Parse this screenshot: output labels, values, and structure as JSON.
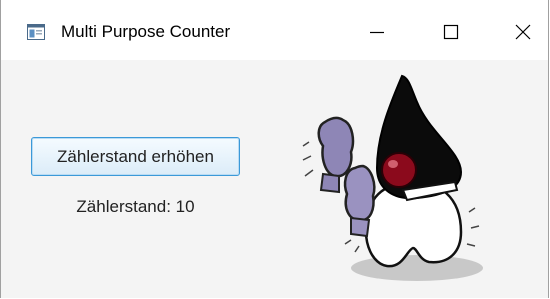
{
  "window": {
    "title": "Multi Purpose Counter",
    "icon": "java-app-icon",
    "controls": {
      "minimize": "minimize-icon",
      "maximize": "maximize-icon",
      "close": "close-icon"
    }
  },
  "main": {
    "increment_button_label": "Zählerstand erhöhen",
    "counter_text": "Zählerstand: 10",
    "image": "java-duke-boxing-mascot"
  },
  "colors": {
    "button_border": "#3b99d8",
    "background": "#f4f4f4",
    "titlebar": "#ffffff"
  }
}
